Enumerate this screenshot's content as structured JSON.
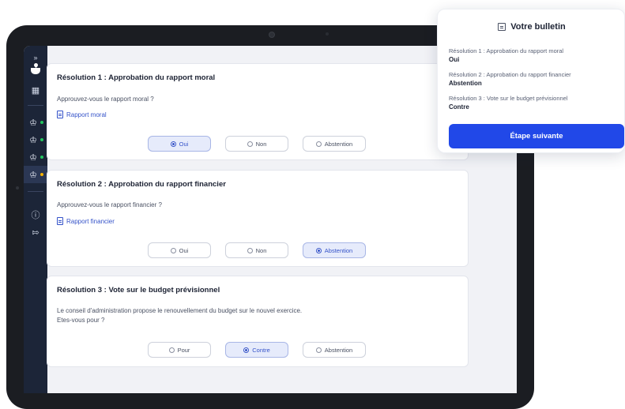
{
  "sidebar": {
    "expand_icon": "»",
    "logo": "app-logo",
    "items": [
      {
        "icon": "vote-icon",
        "status_color": "#22c55e"
      },
      {
        "icon": "vote-icon",
        "status_color": "#22c55e"
      },
      {
        "icon": "vote-icon",
        "status_color": "#22c55e"
      },
      {
        "icon": "vote-icon",
        "status_color": "#f5b200",
        "active": true
      }
    ]
  },
  "resolutions": [
    {
      "title": "Résolution 1 : Approbation du rapport moral",
      "question": "Approuvez-vous le rapport moral ?",
      "link": "Rapport moral",
      "options": [
        "Oui",
        "Non",
        "Abstention"
      ],
      "selected": "Oui"
    },
    {
      "title": "Résolution 2 : Approbation du rapport financier",
      "question": "Approuvez-vous le rapport financier ?",
      "link": "Rapport financier",
      "options": [
        "Oui",
        "Non",
        "Abstention"
      ],
      "selected": "Abstention"
    },
    {
      "title": "Résolution 3 : Vote sur le budget prévisionnel",
      "question_lines": [
        "Le conseil d'administration propose le renouvellement du budget sur le nouvel exercice.",
        "Etes-vous pour ?"
      ],
      "options": [
        "Pour",
        "Contre",
        "Abstention"
      ],
      "selected": "Contre"
    }
  ],
  "ballot": {
    "title": "Votre bulletin",
    "rows": [
      {
        "label": "Résolution 1 : Approbation du rapport moral",
        "value": "Oui"
      },
      {
        "label": "Résolution 2 : Approbation du rapport financier",
        "value": "Abstention"
      },
      {
        "label": "Résolution 3 : Vote sur le budget prévisionnel",
        "value": "Contre"
      }
    ],
    "next_button": "Étape suivante"
  },
  "colors": {
    "accent": "#2148e8",
    "link": "#3553c9",
    "sidebar_bg": "#1c2538",
    "selected_bg": "#e6ebfb"
  }
}
